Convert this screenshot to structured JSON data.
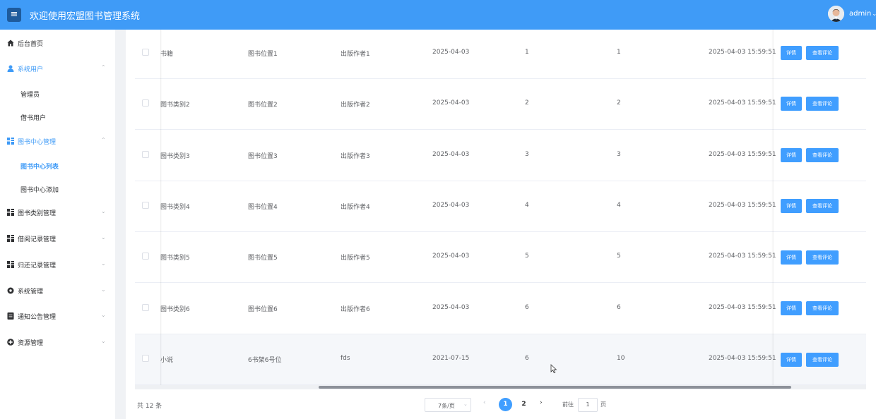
{
  "header": {
    "menu_icon": "hamburger-icon",
    "title": "欢迎使用宏盟图书管理系统",
    "user": "admin",
    "user_caret": "⌄"
  },
  "sidebar": {
    "items": [
      {
        "label": "后台首页",
        "icon": "home-icon",
        "chev": ""
      },
      {
        "label": "系统用户",
        "icon": "user-icon",
        "chev": "⌃"
      },
      {
        "label": "管理员"
      },
      {
        "label": "借书用户"
      },
      {
        "label": "图书中心管理",
        "icon": "grid-icon",
        "chev": "⌃"
      },
      {
        "label": "图书中心列表"
      },
      {
        "label": "图书中心添加"
      },
      {
        "label": "图书类别管理",
        "icon": "grid-icon",
        "chev": "⌄"
      },
      {
        "label": "借阅记录管理",
        "icon": "grid-icon",
        "chev": "⌄"
      },
      {
        "label": "归还记录管理",
        "icon": "grid-icon",
        "chev": "⌄"
      },
      {
        "label": "系统管理",
        "icon": "gear-icon",
        "chev": "⌄"
      },
      {
        "label": "通知公告管理",
        "icon": "document-icon",
        "chev": "⌄"
      },
      {
        "label": "资源管理",
        "icon": "plus-circle-icon",
        "chev": "⌄"
      }
    ]
  },
  "table": {
    "rows": [
      {
        "category": "书籍",
        "location": "图书位置1",
        "author": "出版作者1",
        "date": "2025-04-03",
        "c1": "1",
        "c2": "1",
        "created": "2025-04-03 15:59:51"
      },
      {
        "category": "图书类别2",
        "location": "图书位置2",
        "author": "出版作者2",
        "date": "2025-04-03",
        "c1": "2",
        "c2": "2",
        "created": "2025-04-03 15:59:51"
      },
      {
        "category": "图书类别3",
        "location": "图书位置3",
        "author": "出版作者3",
        "date": "2025-04-03",
        "c1": "3",
        "c2": "3",
        "created": "2025-04-03 15:59:51"
      },
      {
        "category": "图书类别4",
        "location": "图书位置4",
        "author": "出版作者4",
        "date": "2025-04-03",
        "c1": "4",
        "c2": "4",
        "created": "2025-04-03 15:59:51"
      },
      {
        "category": "图书类别5",
        "location": "图书位置5",
        "author": "出版作者5",
        "date": "2025-04-03",
        "c1": "5",
        "c2": "5",
        "created": "2025-04-03 15:59:51"
      },
      {
        "category": "图书类别6",
        "location": "图书位置6",
        "author": "出版作者6",
        "date": "2025-04-03",
        "c1": "6",
        "c2": "6",
        "created": "2025-04-03 15:59:51"
      },
      {
        "category": "小说",
        "location": "6书架6号位",
        "author": "fds",
        "date": "2021-07-15",
        "c1": "6",
        "c2": "10",
        "created": "2025-04-03 15:59:51"
      }
    ],
    "detail_label": "详情",
    "review_label": "查看评论"
  },
  "pagination": {
    "total": "共 12 条",
    "page_size": "7条/页",
    "page_size_caret": "⌄",
    "prev": "‹",
    "pages": [
      "1",
      "2"
    ],
    "next": "›",
    "goto_prefix": "前往",
    "goto_value": "1",
    "goto_suffix": "页"
  },
  "colors": {
    "header": "#3f9bf7",
    "primary": "#409eff",
    "sidebar_active": "#3f9bf7"
  }
}
